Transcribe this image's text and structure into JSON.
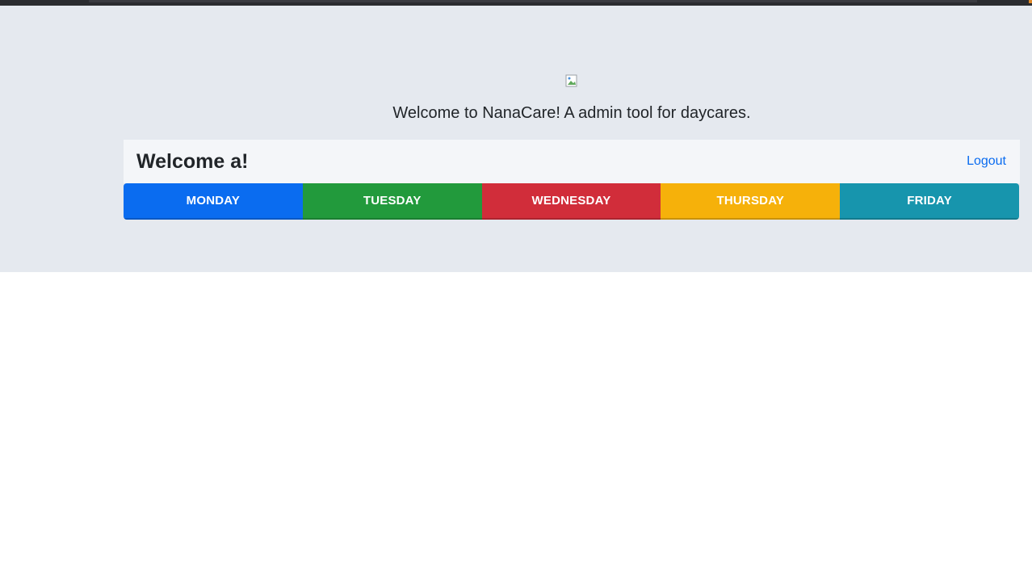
{
  "hero": {
    "tagline": "Welcome to NanaCare! A admin tool for daycares."
  },
  "header": {
    "welcome": "Welcome a!",
    "logout_label": "Logout"
  },
  "days": [
    {
      "label": "MONDAY",
      "color": "#0a6cf0"
    },
    {
      "label": "TUESDAY",
      "color": "#229a3c"
    },
    {
      "label": "WEDNESDAY",
      "color": "#d12d3a"
    },
    {
      "label": "THURSDAY",
      "color": "#f6b10a"
    },
    {
      "label": "FRIDAY",
      "color": "#1795ad"
    }
  ],
  "colors": {
    "link": "#0a6cf0",
    "jumbotron_bg": "#e5e9ef",
    "card_header_bg": "#f4f6f9"
  }
}
